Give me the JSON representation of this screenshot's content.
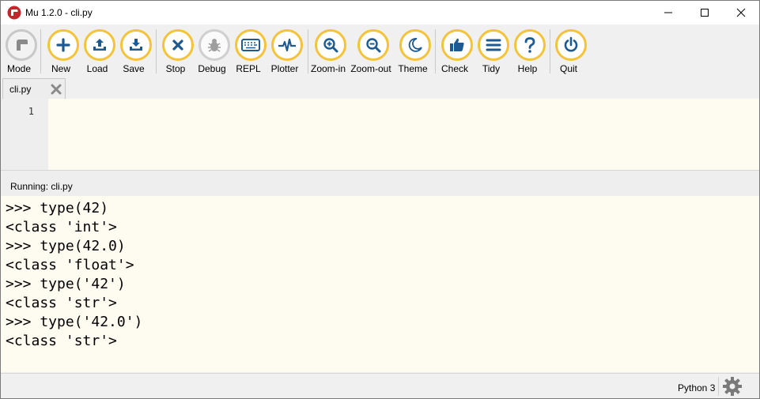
{
  "window": {
    "title": "Mu 1.2.0 - cli.py"
  },
  "toolbar": {
    "buttons": [
      {
        "label": "Mode"
      },
      {
        "label": "New"
      },
      {
        "label": "Load"
      },
      {
        "label": "Save"
      },
      {
        "label": "Stop"
      },
      {
        "label": "Debug"
      },
      {
        "label": "REPL"
      },
      {
        "label": "Plotter"
      },
      {
        "label": "Zoom-in"
      },
      {
        "label": "Zoom-out"
      },
      {
        "label": "Theme"
      },
      {
        "label": "Check"
      },
      {
        "label": "Tidy"
      },
      {
        "label": "Help"
      },
      {
        "label": "Quit"
      }
    ]
  },
  "tabs": [
    {
      "label": "cli.py"
    }
  ],
  "editor": {
    "line_numbers": [
      "1"
    ]
  },
  "repl": {
    "title": "Running: cli.py",
    "lines": [
      ">>> type(42)",
      "<class 'int'>",
      ">>> type(42.0)",
      "<class 'float'>",
      ">>> type('42')",
      "<class 'str'>",
      ">>> type('42.0')",
      "<class 'str'>"
    ]
  },
  "status": {
    "mode": "Python 3"
  },
  "colors": {
    "accent": "#f4c33c",
    "icon": "#1e5a92",
    "editor_bg": "#fefbf0"
  }
}
